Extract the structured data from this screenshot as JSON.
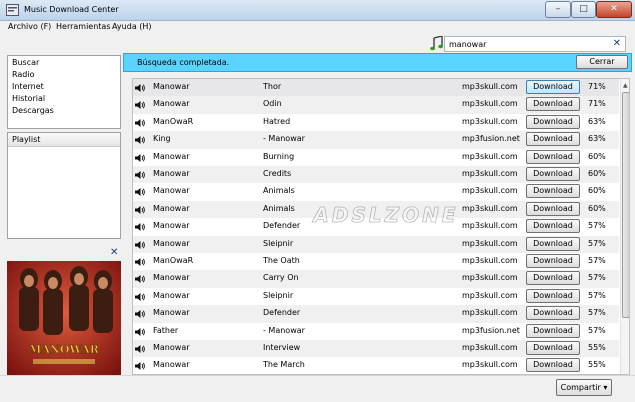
{
  "window": {
    "title": "Music Download Center",
    "controls": {
      "minimize": "–",
      "maximize": "□",
      "close": "✕"
    }
  },
  "menu": [
    {
      "label": "Archivo (F)"
    },
    {
      "label": "Herramientas"
    },
    {
      "label": "Ayuda (H)"
    }
  ],
  "search": {
    "value": "manowar",
    "clear": "✕"
  },
  "nav": [
    "Buscar",
    "Radio",
    "Internet",
    "Historial",
    "Descargas"
  ],
  "playlist": {
    "header": "Playlist"
  },
  "album_art": {
    "close": "✕",
    "band_text": "MANOWAR"
  },
  "infobar": {
    "message": "Búsqueda completada.",
    "close_label": "Cerrar"
  },
  "download_label": "Download",
  "results": [
    {
      "artist": "Manowar",
      "title": "Thor",
      "source": "mp3skull.com",
      "pct": "71%"
    },
    {
      "artist": "Manowar",
      "title": "Odin",
      "source": "mp3skull.com",
      "pct": "71%"
    },
    {
      "artist": "ManOwaR",
      "title": "Hatred",
      "source": "mp3skull.com",
      "pct": "63%"
    },
    {
      "artist": "King",
      "title": "- Manowar",
      "source": "mp3fusion.net",
      "pct": "63%"
    },
    {
      "artist": "Manowar",
      "title": "Burning",
      "source": "mp3skull.com",
      "pct": "60%"
    },
    {
      "artist": "Manowar",
      "title": "Credits",
      "source": "mp3skull.com",
      "pct": "60%"
    },
    {
      "artist": "Manowar",
      "title": "Animals",
      "source": "mp3skull.com",
      "pct": "60%"
    },
    {
      "artist": "Manowar",
      "title": "Animals",
      "source": "mp3skull.com",
      "pct": "60%"
    },
    {
      "artist": "Manowar",
      "title": "Defender",
      "source": "mp3skull.com",
      "pct": "57%"
    },
    {
      "artist": "Manowar",
      "title": "Sleipnir",
      "source": "mp3skull.com",
      "pct": "57%"
    },
    {
      "artist": "ManOwaR",
      "title": "The Oath",
      "source": "mp3skull.com",
      "pct": "57%"
    },
    {
      "artist": "Manowar",
      "title": "Carry On",
      "source": "mp3skull.com",
      "pct": "57%"
    },
    {
      "artist": "Manowar",
      "title": "Sleipnir",
      "source": "mp3skull.com",
      "pct": "57%"
    },
    {
      "artist": "Manowar",
      "title": "Defender",
      "source": "mp3skull.com",
      "pct": "57%"
    },
    {
      "artist": "Father",
      "title": "- Manowar",
      "source": "mp3fusion.net",
      "pct": "57%"
    },
    {
      "artist": "Manowar",
      "title": "Interview",
      "source": "mp3skull.com",
      "pct": "55%"
    },
    {
      "artist": "Manowar",
      "title": "The March",
      "source": "mp3skull.com",
      "pct": "55%"
    }
  ],
  "watermark": "ADSLZONE",
  "status": {
    "share_label": "Compartir ▾"
  },
  "colors": {
    "infobar": "#5bd3ff",
    "accent": "#1c3d7a"
  }
}
